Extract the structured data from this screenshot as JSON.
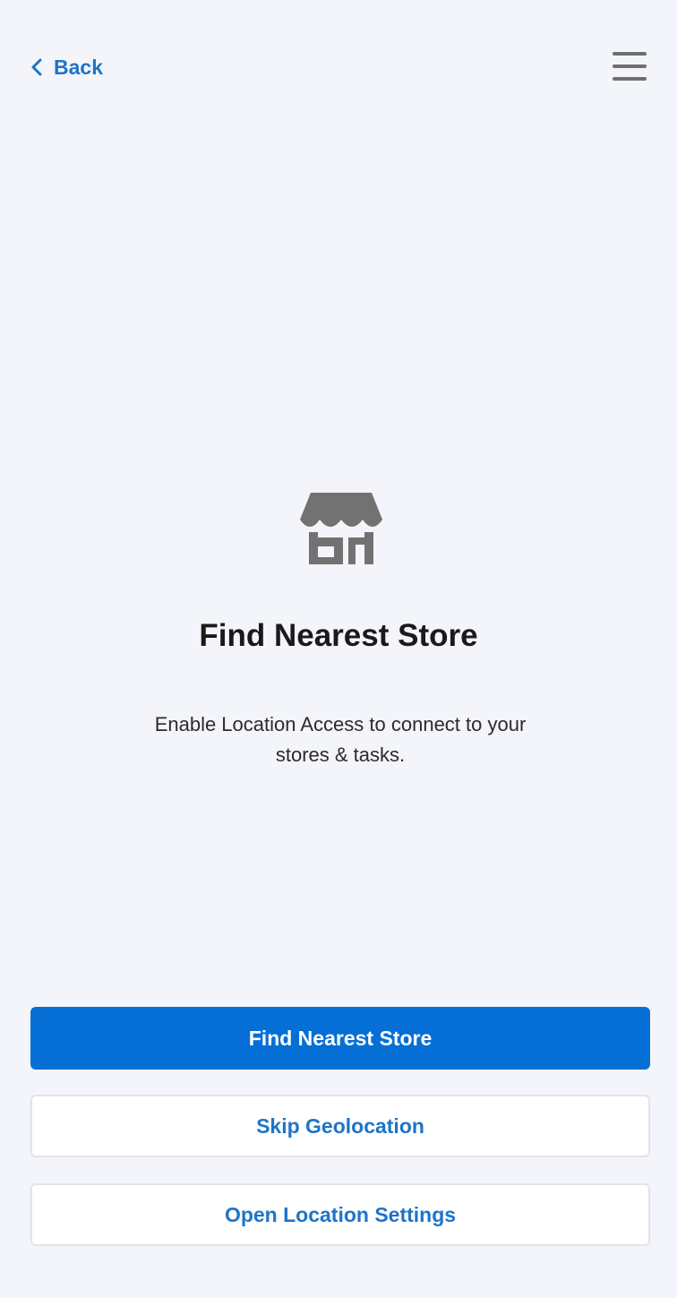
{
  "header": {
    "back_label": "Back",
    "back_icon": "chevron-left-icon",
    "menu_icon": "hamburger-menu-icon"
  },
  "hero": {
    "icon": "store-icon",
    "title": "Find Nearest Store",
    "description": "Enable Location Access to connect to your stores & tasks."
  },
  "actions": {
    "find_store_label": "Find Nearest Store",
    "skip_label": "Skip Geolocation",
    "settings_label": "Open Location Settings"
  },
  "colors": {
    "background": "#f3f5fa",
    "accent": "#066fd6",
    "link": "#1f74c8",
    "icon_gray": "#727272"
  }
}
